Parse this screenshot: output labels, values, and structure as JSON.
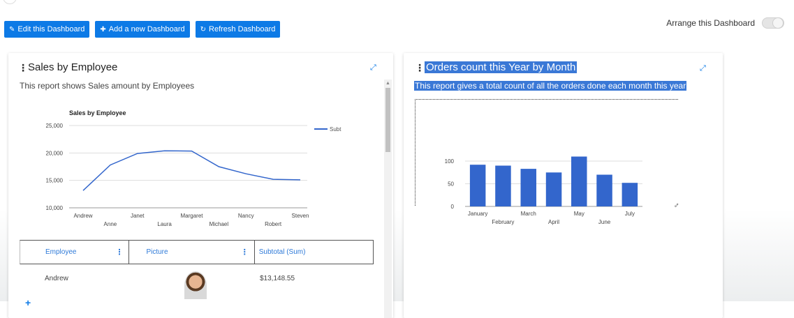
{
  "toolbar": {
    "edit": "Edit this Dashboard",
    "add": "Add a new Dashboard",
    "refresh": "Refresh Dashboard",
    "arrange": "Arrange this Dashboard"
  },
  "card1": {
    "title": "Sales by Employee",
    "description": "This report shows Sales amount by Employees",
    "chart_title": "Sales by Employee",
    "legend": "Subt",
    "table": {
      "headers": [
        "Employee",
        "Picture",
        "Subtotal (Sum)"
      ],
      "rows": [
        {
          "employee": "Andrew",
          "subtotal": "$13,148.55"
        }
      ]
    }
  },
  "card2": {
    "title": "Orders count this Year by Month",
    "description": "This report gives a total count of all the orders done each month this year"
  },
  "colors": {
    "accent": "#0d7ae6",
    "series": "#3366cc",
    "highlight": "#3a78d6"
  },
  "chart_data": [
    {
      "type": "line",
      "title": "Sales by Employee",
      "categories": [
        "Andrew",
        "Anne",
        "Janet",
        "Laura",
        "Margaret",
        "Michael",
        "Nancy",
        "Robert",
        "Steven"
      ],
      "series": [
        {
          "name": "Subt",
          "values": [
            13148,
            17800,
            19900,
            20400,
            20350,
            17500,
            16200,
            15200,
            15100
          ]
        }
      ],
      "yticks": [
        "25,000",
        "20,000",
        "15,000",
        "10,000"
      ],
      "ylim": [
        10000,
        25000
      ],
      "legend": "right"
    },
    {
      "type": "bar",
      "categories": [
        "January",
        "February",
        "March",
        "April",
        "May",
        "June",
        "July"
      ],
      "values": [
        92,
        90,
        83,
        75,
        110,
        70,
        52
      ],
      "yticks": [
        "100",
        "50",
        "0"
      ],
      "ylim": [
        0,
        120
      ]
    }
  ]
}
